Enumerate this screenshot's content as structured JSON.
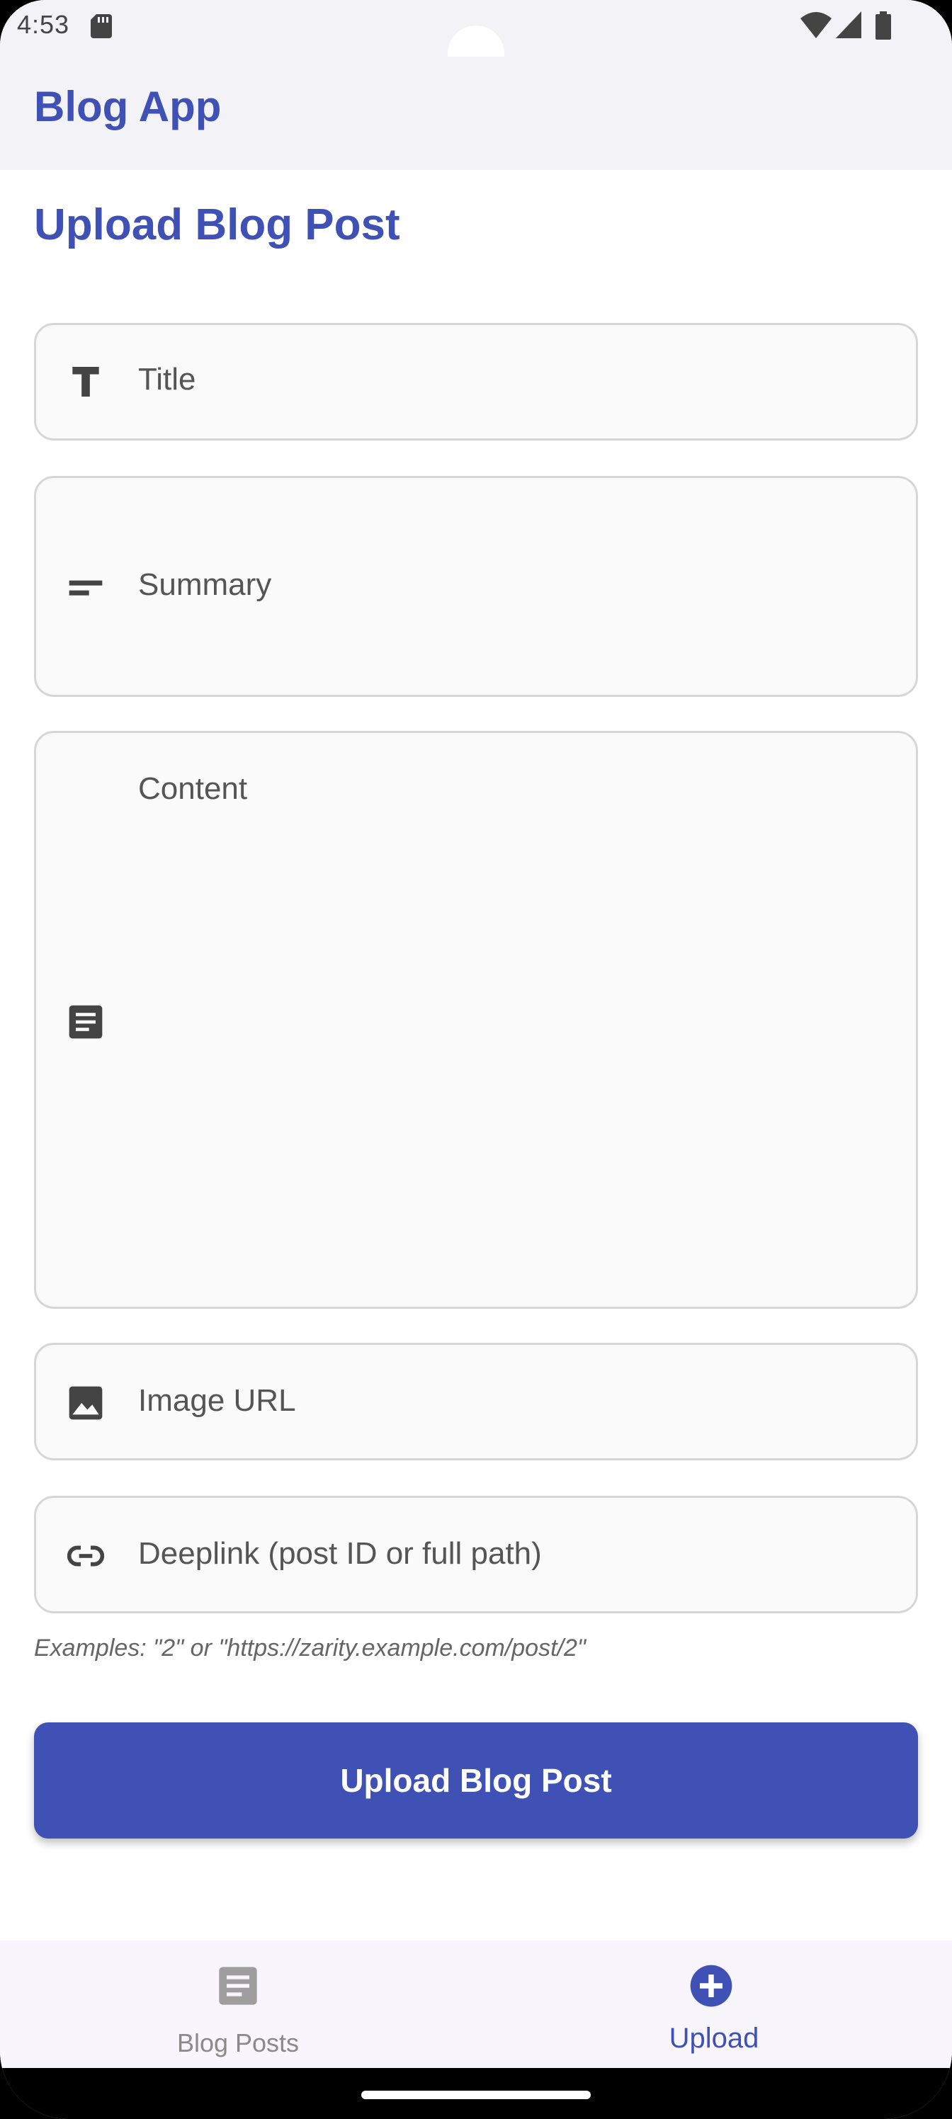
{
  "status_bar": {
    "time": "4:53",
    "icons": [
      "sd-card-icon",
      "wifi-icon",
      "signal-icon",
      "battery-icon"
    ]
  },
  "app_bar": {
    "title": "Blog App"
  },
  "main": {
    "page_title": "Upload Blog Post",
    "fields": {
      "title": {
        "placeholder": "Title",
        "icon": "text-fields-icon"
      },
      "summary": {
        "placeholder": "Summary",
        "icon": "short-text-icon"
      },
      "content": {
        "placeholder": "Content",
        "icon": "article-icon"
      },
      "image_url": {
        "placeholder": "Image URL",
        "icon": "image-icon"
      },
      "deeplink": {
        "placeholder": "Deeplink (post ID or full path)",
        "icon": "link-icon"
      }
    },
    "hint": "Examples: \"2\" or \"https://zarity.example.com/post/2\"",
    "submit_label": "Upload Blog Post"
  },
  "bottom_nav": {
    "items": [
      {
        "label": "Blog Posts",
        "icon": "article-icon",
        "selected": false
      },
      {
        "label": "Upload",
        "icon": "add-circle-icon",
        "selected": true
      }
    ]
  },
  "colors": {
    "primary": "#3f51b5",
    "field_bg": "#fafafa",
    "field_border": "#d6d6d6",
    "bar_bg": "#f2f2f7"
  }
}
